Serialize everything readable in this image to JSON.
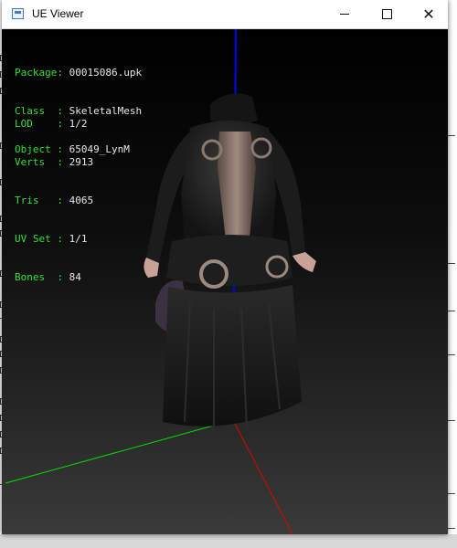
{
  "window": {
    "title": "UE Viewer"
  },
  "mesh_info": {
    "group1": [
      {
        "label": "Package",
        "value": "00015086.upk"
      },
      {
        "label": "Class",
        "value": "SkeletalMesh"
      },
      {
        "label": "Object",
        "value": "65049_LynM"
      }
    ],
    "group2": [
      {
        "label": "LOD",
        "value": "1/2"
      },
      {
        "label": "Verts",
        "value": "2913"
      },
      {
        "label": "Tris",
        "value": "4065"
      },
      {
        "label": "UV Set",
        "value": "1/1"
      },
      {
        "label": "Bones",
        "value": "84"
      }
    ]
  },
  "axes": {
    "x_color": "#00e000",
    "y_color": "#e00000",
    "z_color": "#0000ff"
  }
}
